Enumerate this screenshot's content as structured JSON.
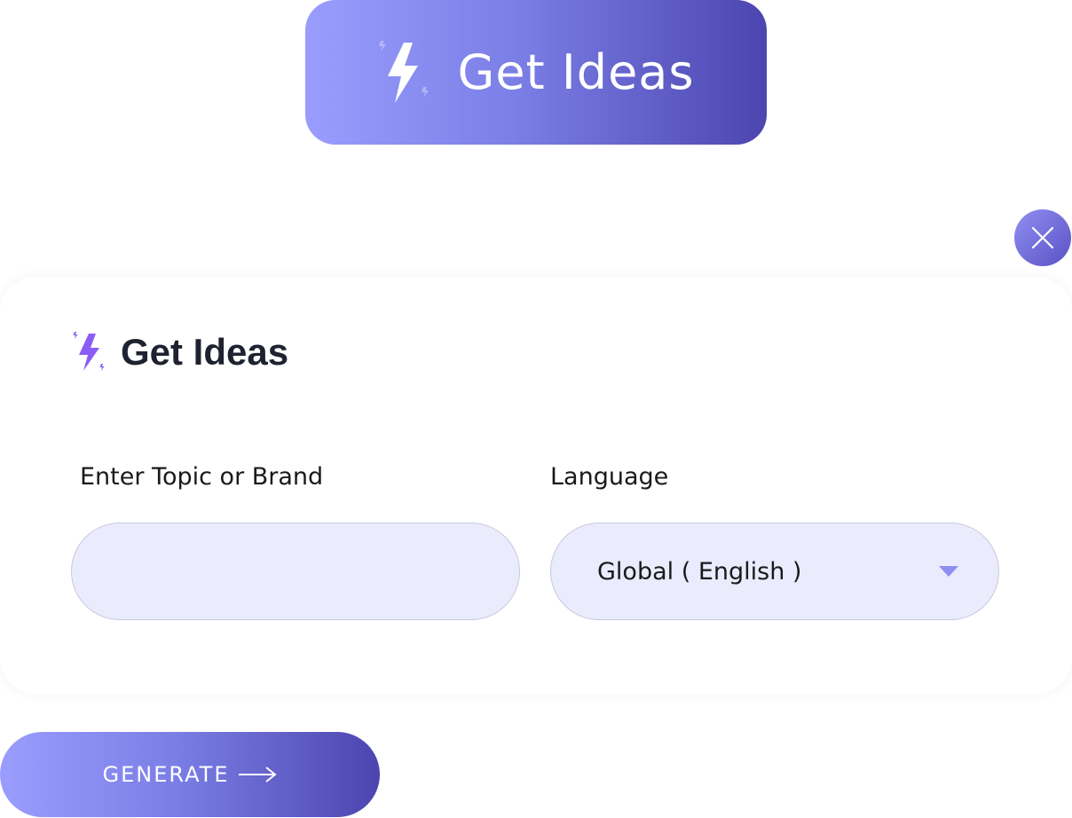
{
  "top_button": {
    "label": "Get Ideas",
    "icon": "lightning-sparkle-icon"
  },
  "close_button": {
    "icon": "close-icon"
  },
  "panel": {
    "title": "Get Ideas",
    "icon": "lightning-sparkle-icon",
    "topic_field": {
      "label": "Enter Topic or Brand",
      "value": "",
      "placeholder": ""
    },
    "language_field": {
      "label": "Language",
      "selected": "Global ( English )",
      "icon": "caret-down-icon"
    }
  },
  "generate_button": {
    "label": "GENERATE",
    "icon": "arrow-right-icon"
  },
  "colors": {
    "accent_start": "#9a9dfd",
    "accent_end": "#4c45b0",
    "input_bg": "#eaebfd",
    "heading_icon": "#8b5cf6",
    "caret": "#8e8ef0"
  }
}
